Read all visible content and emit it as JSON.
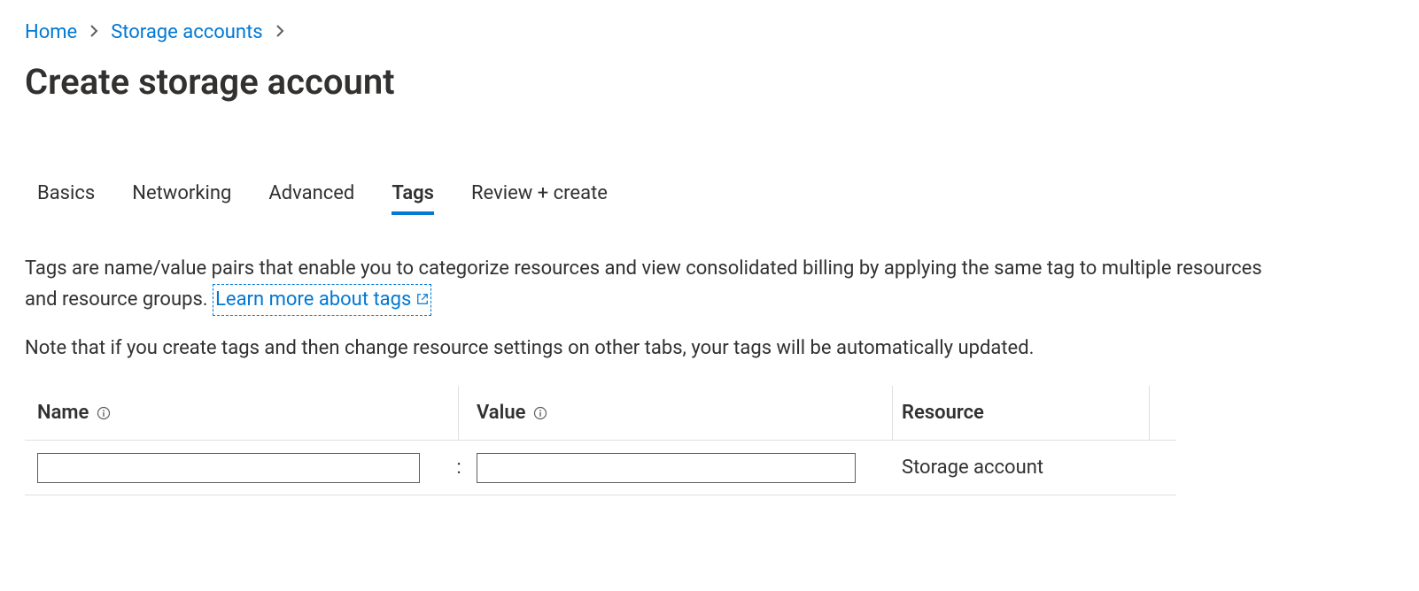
{
  "breadcrumb": {
    "home": "Home",
    "storage_accounts": "Storage accounts"
  },
  "page_title": "Create storage account",
  "tabs": {
    "basics": "Basics",
    "networking": "Networking",
    "advanced": "Advanced",
    "tags": "Tags",
    "review": "Review + create"
  },
  "description": {
    "text_before": "Tags are name/value pairs that enable you to categorize resources and view consolidated billing by applying the same tag to multiple resources and resource groups. ",
    "link_text": "Learn more about tags"
  },
  "note": "Note that if you create tags and then change resource settings on other tabs, your tags will be automatically updated.",
  "columns": {
    "name": "Name",
    "value": "Value",
    "resource": "Resource"
  },
  "row": {
    "name_value": "",
    "value_value": "",
    "separator": ":",
    "resource": "Storage account"
  }
}
